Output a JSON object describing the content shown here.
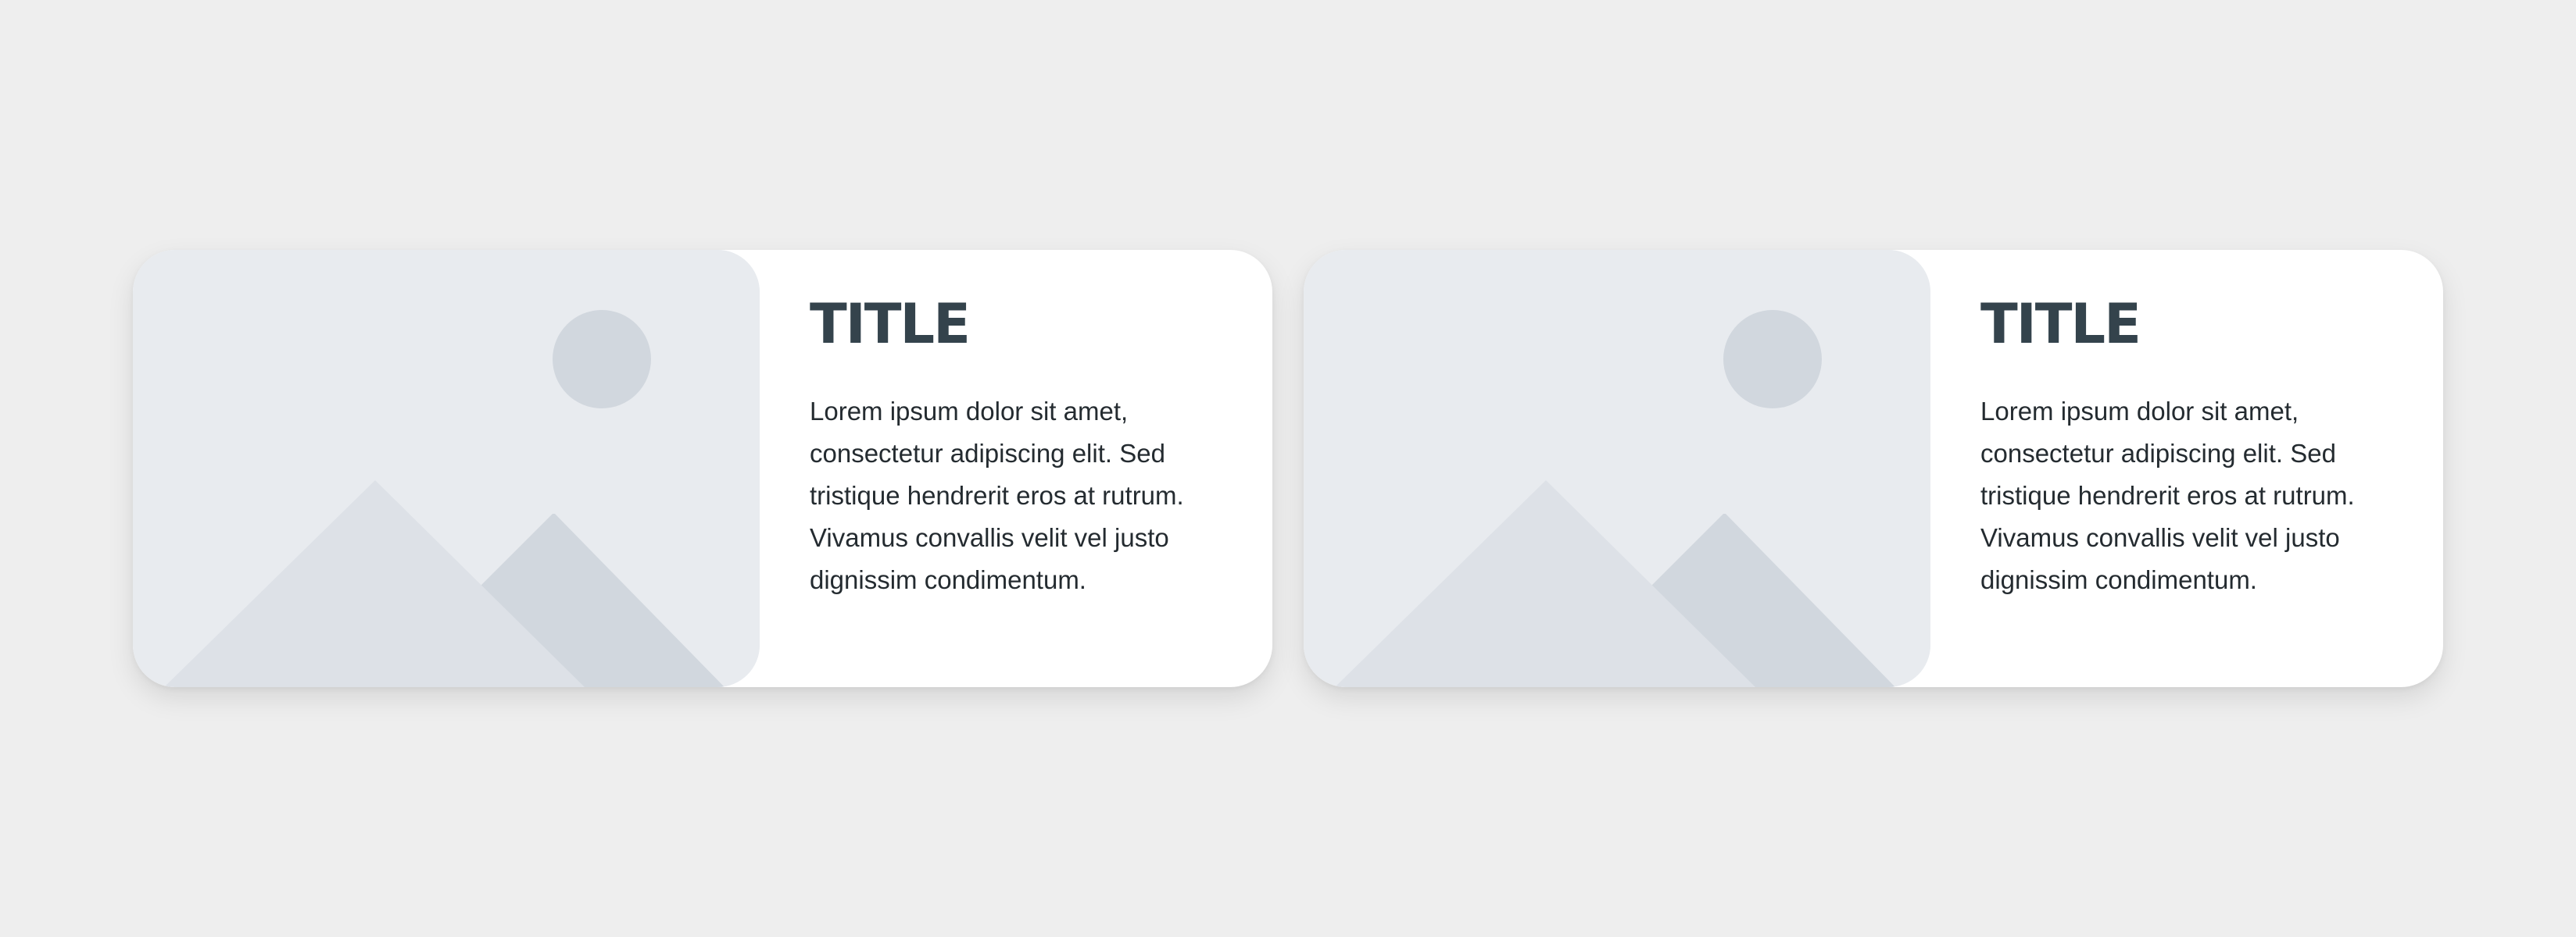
{
  "cards": [
    {
      "title": "TITLE",
      "body": "Lorem ipsum dolor sit amet, consectetur adipiscing elit. Sed tristique hendrerit eros at rutrum. Vivamus convallis velit vel justo dignissim condimentum.",
      "image_icon": "image-placeholder-icon"
    },
    {
      "title": "TITLE",
      "body": "Lorem ipsum dolor sit amet, consectetur adipiscing elit. Sed tristique hendrerit eros at rutrum. Vivamus convallis velit vel justo dignissim condimentum.",
      "image_icon": "image-placeholder-icon"
    }
  ],
  "colors": {
    "page_background": "#eeeeee",
    "card_background": "#ffffff",
    "placeholder_background": "#e8ebef",
    "placeholder_shape_light": "#dde1e7",
    "placeholder_shape_dark": "#d1d7de",
    "title": "#34434c",
    "body_text": "#242b30"
  }
}
